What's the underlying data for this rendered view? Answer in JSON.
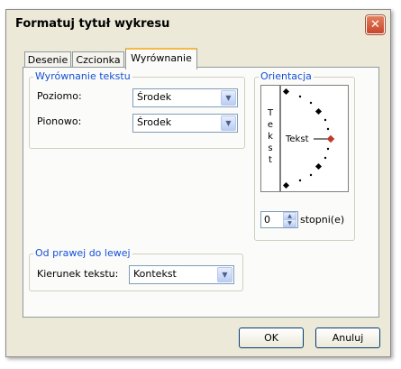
{
  "window": {
    "title": "Formatuj tytuł wykresu"
  },
  "icons": {
    "close": "close-icon",
    "combo_arrow": "chevron-down-icon",
    "spin_up": "chevron-up-icon",
    "spin_down": "chevron-down-icon"
  },
  "tabs": [
    {
      "label": "Desenie"
    },
    {
      "label": "Czcionka"
    },
    {
      "label": "Wyrównanie"
    }
  ],
  "alignment": {
    "legend": "Wyrównanie tekstu",
    "horizontal_label": "Poziomo:",
    "horizontal_value": "Środek",
    "vertical_label": "Pionowo:",
    "vertical_value": "Środek"
  },
  "orientation": {
    "legend": "Orientacja",
    "vertical_text": "T\ne\nk\ns\nt",
    "dial_label": "Tekst",
    "degrees_value": "0",
    "degrees_label": "stopni(e)"
  },
  "rtl": {
    "legend": "Od prawej do lewej",
    "direction_label": "Kierunek tekstu:",
    "direction_value": "Kontekst"
  },
  "buttons": {
    "ok": "OK",
    "cancel": "Anuluj"
  },
  "colors": {
    "accent": "#1550d8",
    "tab_highlight": "#f5b948",
    "dial_marker": "#c0392b"
  }
}
